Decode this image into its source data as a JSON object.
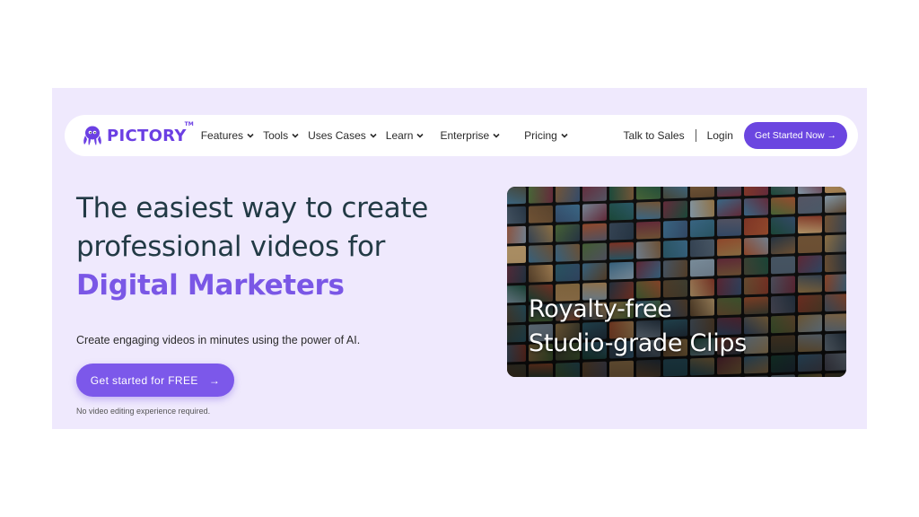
{
  "brand": {
    "name": "PICTORY",
    "trademark": "TM"
  },
  "nav": {
    "items": [
      {
        "label": "Features"
      },
      {
        "label": "Tools"
      },
      {
        "label": "Uses Cases"
      },
      {
        "label": "Learn"
      },
      {
        "label": "Enterprise"
      },
      {
        "label": "Pricing"
      }
    ],
    "talk_to_sales": "Talk to Sales",
    "separator": "|",
    "login": "Login",
    "cta": "Get Started Now →"
  },
  "hero": {
    "headline_line1": "The easiest way to create",
    "headline_line2": "professional videos for",
    "headline_accent": "Digital Marketers",
    "subtext": "Create engaging videos in minutes using the power of AI.",
    "cta_label": "Get started for FREE",
    "cta_arrow": "→",
    "note": "No video editing experience required."
  },
  "promo": {
    "line1": "Royalty-free",
    "line2": "Studio-grade Clips"
  },
  "colors": {
    "brand": "#6b3fe3",
    "hero_bg": "#efe9fd",
    "accent_text": "#7a57e6",
    "button": "#7c58ea"
  }
}
